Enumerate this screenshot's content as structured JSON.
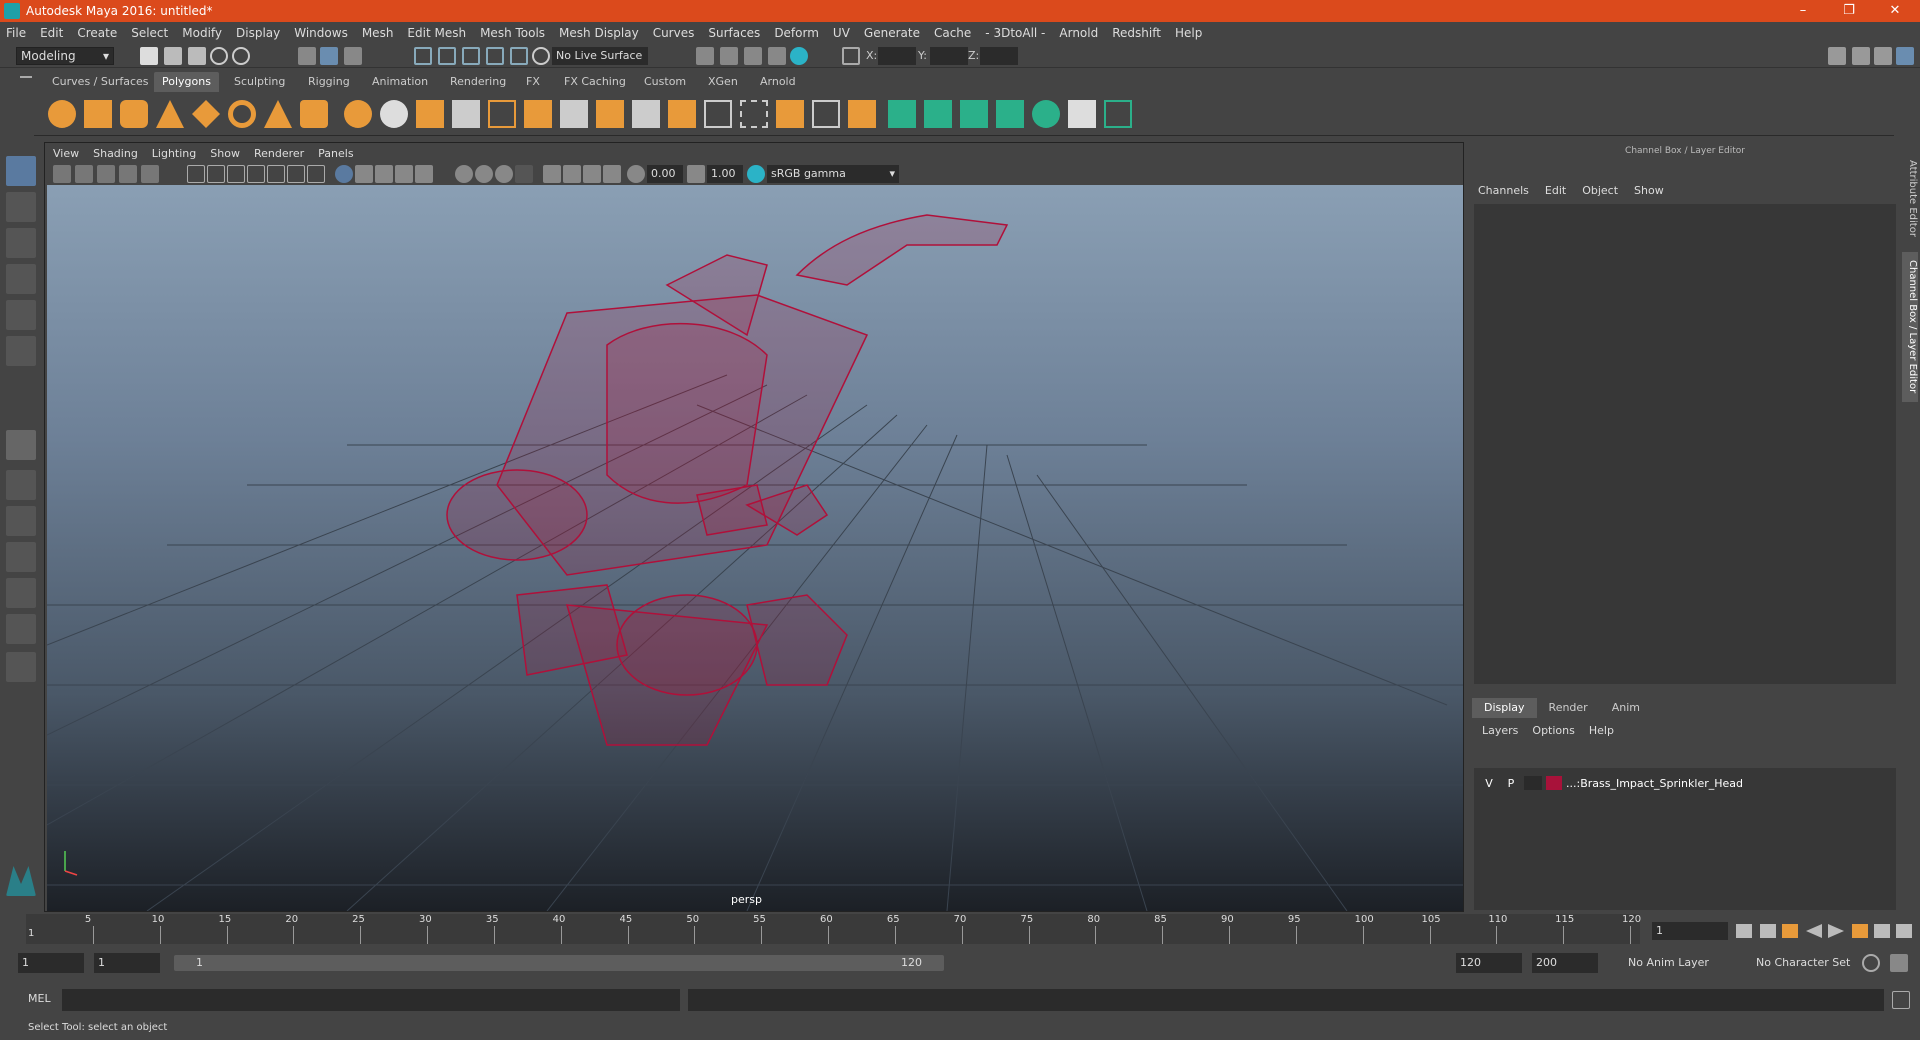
{
  "window": {
    "title": "Autodesk Maya 2016: untitled*"
  },
  "menu": [
    "File",
    "Edit",
    "Create",
    "Select",
    "Modify",
    "Display",
    "Windows",
    "Mesh",
    "Edit Mesh",
    "Mesh Tools",
    "Mesh Display",
    "Curves",
    "Surfaces",
    "Deform",
    "UV",
    "Generate",
    "Cache",
    "- 3DtoAll -",
    "Arnold",
    "Redshift",
    "Help"
  ],
  "status": {
    "mode": "Modeling",
    "live_surface": "No Live Surface",
    "x_label": "X:",
    "y_label": "Y:",
    "z_label": "Z:"
  },
  "shelf_tabs": [
    "Curves / Surfaces",
    "Polygons",
    "Sculpting",
    "Rigging",
    "Animation",
    "Rendering",
    "FX",
    "FX Caching",
    "Custom",
    "XGen",
    "Arnold"
  ],
  "shelf_active": "Polygons",
  "viewport": {
    "menu": [
      "View",
      "Shading",
      "Lighting",
      "Show",
      "Renderer",
      "Panels"
    ],
    "near": "0.00",
    "far": "1.00",
    "color_space": "sRGB gamma",
    "camera": "persp"
  },
  "channel_box": {
    "title": "Channel Box / Layer Editor",
    "menu": [
      "Channels",
      "Edit",
      "Object",
      "Show"
    ]
  },
  "layer_editor": {
    "tabs": [
      "Display",
      "Render",
      "Anim"
    ],
    "active_tab": "Display",
    "menu": [
      "Layers",
      "Options",
      "Help"
    ],
    "layer": {
      "v": "V",
      "p": "P",
      "name": "...:Brass_Impact_Sprinkler_Head",
      "color": "#a8123a"
    }
  },
  "side_tabs": [
    "Attribute Editor",
    "Channel Box / Layer Editor"
  ],
  "timeline": {
    "ticks": [
      "5",
      "10",
      "15",
      "20",
      "25",
      "30",
      "35",
      "40",
      "45",
      "50",
      "55",
      "60",
      "65",
      "70",
      "75",
      "80",
      "85",
      "90",
      "95",
      "100",
      "105",
      "110",
      "115",
      "120"
    ],
    "start_tick": "1",
    "current_frame": "1"
  },
  "range": {
    "start": "1",
    "anim_start": "1",
    "slider_start": "1",
    "slider_end": "120",
    "anim_end": "120",
    "end": "200",
    "anim_layer": "No Anim Layer",
    "char_set": "No Character Set"
  },
  "command": {
    "label": "MEL"
  },
  "help": "Select Tool: select an object",
  "colors": {
    "title_bar": "#db4a1c",
    "wireframe": "#b0103a",
    "panel": "#444444"
  }
}
